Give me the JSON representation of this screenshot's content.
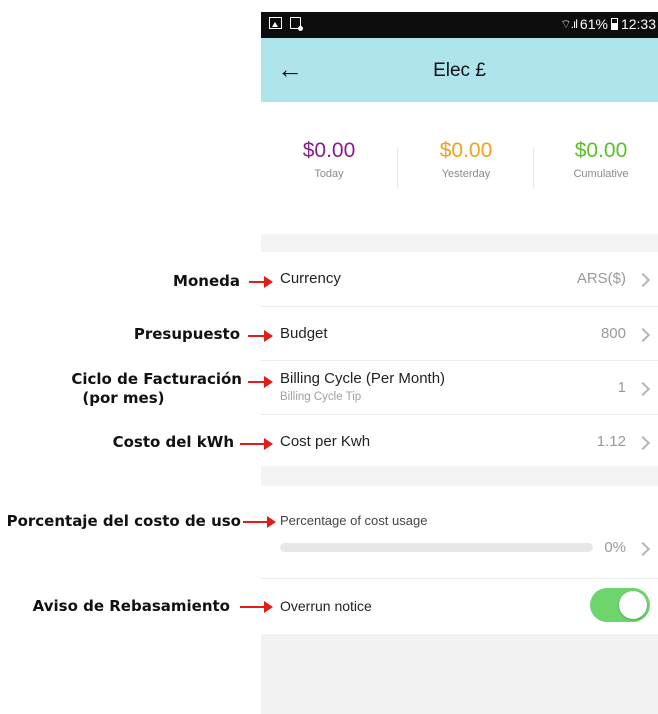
{
  "status_bar": {
    "battery": "61%",
    "time": "12:33"
  },
  "app_bar": {
    "title": "Elec £"
  },
  "stats": [
    {
      "value": "$0.00",
      "label": "Today",
      "color": "#8b1c8f"
    },
    {
      "value": "$0.00",
      "label": "Yesterday",
      "color": "#f2a11d"
    },
    {
      "value": "$0.00",
      "label": "Cumulative",
      "color": "#5bbf2a"
    }
  ],
  "settings": {
    "currency": {
      "label": "Currency",
      "value": "ARS($)"
    },
    "budget": {
      "label": "Budget",
      "value": "800"
    },
    "billing_cycle": {
      "label": "Billing Cycle (Per Month)",
      "sublabel": "Billing Cycle Tip",
      "value": "1"
    },
    "cost_per_kwh": {
      "label": "Cost per Kwh",
      "value": "1.12"
    },
    "cost_usage": {
      "label": "Percentage of cost usage",
      "value": "0%",
      "progress": 0
    },
    "overrun": {
      "label": "Overrun notice",
      "enabled": true
    }
  },
  "annotations": {
    "currency": "Moneda",
    "budget": "Presupuesto",
    "billing_line1": "Ciclo de Facturación",
    "billing_line2": "(por mes)",
    "cost_kwh": "Costo del kWh",
    "usage": "Porcentaje del costo de uso",
    "overrun": "Aviso de Rebasamiento"
  },
  "colors": {
    "accent_bar": "#aee5ec",
    "arrow": "#e21b1b",
    "toggle_on": "#6dd56b"
  }
}
